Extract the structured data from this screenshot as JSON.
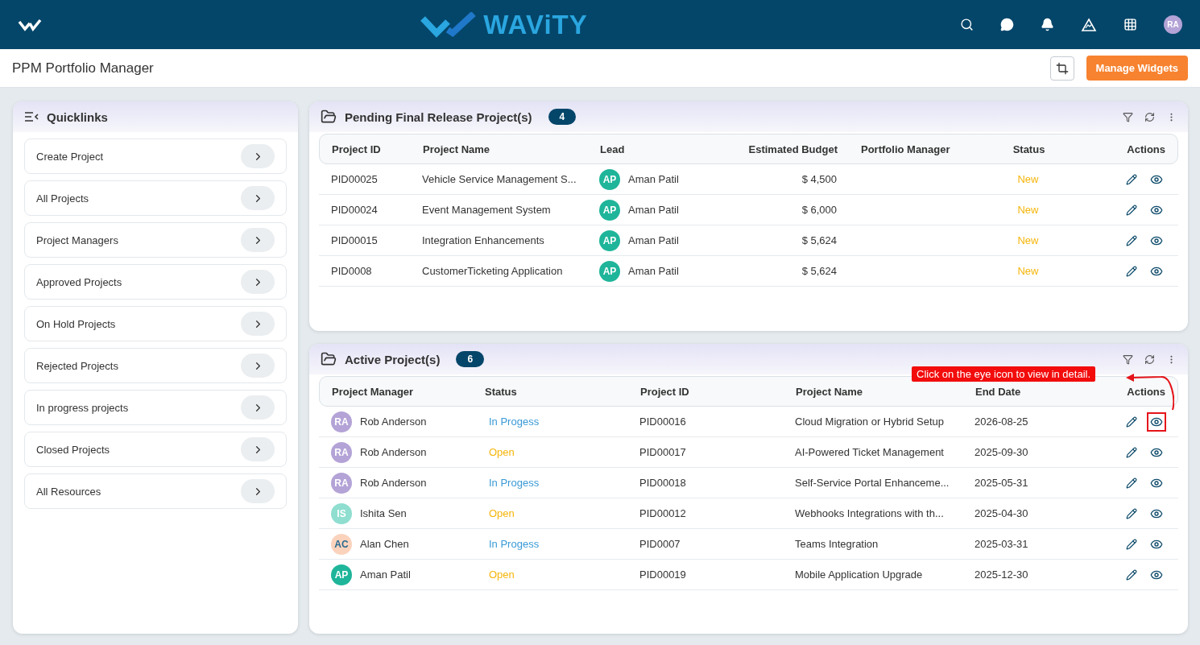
{
  "topbar": {
    "brand": "WAViTY",
    "avatar": "RA"
  },
  "page": {
    "title": "PPM Portfolio Manager",
    "manage_button": "Manage Widgets"
  },
  "quicklinks": {
    "title": "Quicklinks",
    "items": [
      {
        "label": "Create Project"
      },
      {
        "label": "All Projects"
      },
      {
        "label": "Project Managers"
      },
      {
        "label": "Approved Projects"
      },
      {
        "label": "On Hold Projects"
      },
      {
        "label": "Rejected Projects"
      },
      {
        "label": "In progress projects"
      },
      {
        "label": "Closed Projects"
      },
      {
        "label": "All Resources"
      }
    ]
  },
  "pending": {
    "title": "Pending Final Release Project(s)",
    "count": "4",
    "columns": [
      "Project ID",
      "Project Name",
      "Lead",
      "Estimated Budget",
      "Portfolio Manager",
      "Status",
      "Actions"
    ],
    "rows": [
      {
        "id": "PID00025",
        "name": "Vehicle Service Management S...",
        "lead": {
          "initials": "AP",
          "name": "Aman Patil",
          "color": "#1fb59a"
        },
        "budget": "$ 4,500",
        "status": {
          "text": "New",
          "color": "#f5b50a"
        }
      },
      {
        "id": "PID00024",
        "name": "Event Management System",
        "lead": {
          "initials": "AP",
          "name": "Aman Patil",
          "color": "#1fb59a"
        },
        "budget": "$ 6,000",
        "status": {
          "text": "New",
          "color": "#f5b50a"
        }
      },
      {
        "id": "PID00015",
        "name": "Integration Enhancements",
        "lead": {
          "initials": "AP",
          "name": "Aman Patil",
          "color": "#1fb59a"
        },
        "budget": "$ 5,624",
        "status": {
          "text": "New",
          "color": "#f5b50a"
        }
      },
      {
        "id": "PID0008",
        "name": "CustomerTicketing Application",
        "lead": {
          "initials": "AP",
          "name": "Aman Patil",
          "color": "#1fb59a"
        },
        "budget": "$ 5,624",
        "status": {
          "text": "New",
          "color": "#f5b50a"
        }
      }
    ]
  },
  "active": {
    "title": "Active Project(s)",
    "count": "6",
    "columns": [
      "Project Manager",
      "Status",
      "Project ID",
      "Project Name",
      "End Date",
      "Actions"
    ],
    "annotation": "Click on the eye icon to view in detail.",
    "rows": [
      {
        "manager": {
          "initials": "RA",
          "name": "Rob Anderson",
          "color": "#b3a3d6"
        },
        "status": {
          "text": "In Progess",
          "color": "#3a9ad6"
        },
        "id": "PID00016",
        "name": "Cloud Migration or Hybrid Setup",
        "end": "2026-08-25",
        "highlighted": true
      },
      {
        "manager": {
          "initials": "RA",
          "name": "Rob Anderson",
          "color": "#b3a3d6"
        },
        "status": {
          "text": "Open",
          "color": "#f5b50a"
        },
        "id": "PID00017",
        "name": "AI-Powered Ticket Management",
        "end": "2025-09-30",
        "highlighted": false
      },
      {
        "manager": {
          "initials": "RA",
          "name": "Rob Anderson",
          "color": "#b3a3d6"
        },
        "status": {
          "text": "In Progess",
          "color": "#3a9ad6"
        },
        "id": "PID00018",
        "name": "Self-Service Portal Enhanceme...",
        "end": "2025-05-31",
        "highlighted": false
      },
      {
        "manager": {
          "initials": "IS",
          "name": "Ishita Sen",
          "color": "#8fded0"
        },
        "status": {
          "text": "Open",
          "color": "#f5b50a"
        },
        "id": "PID00012",
        "name": "Webhooks Integrations with th...",
        "end": "2025-04-30",
        "highlighted": false
      },
      {
        "manager": {
          "initials": "AC",
          "name": "Alan Chen",
          "color": "#fbd3bd"
        },
        "status": {
          "text": "In Progess",
          "color": "#3a9ad6"
        },
        "id": "PID0007",
        "name": "Teams Integration",
        "end": "2025-03-31",
        "highlighted": false
      },
      {
        "manager": {
          "initials": "AP",
          "name": "Aman Patil",
          "color": "#1fb59a"
        },
        "status": {
          "text": "Open",
          "color": "#f5b50a"
        },
        "id": "PID00019",
        "name": "Mobile Application Upgrade",
        "end": "2025-12-30",
        "highlighted": false
      }
    ]
  }
}
